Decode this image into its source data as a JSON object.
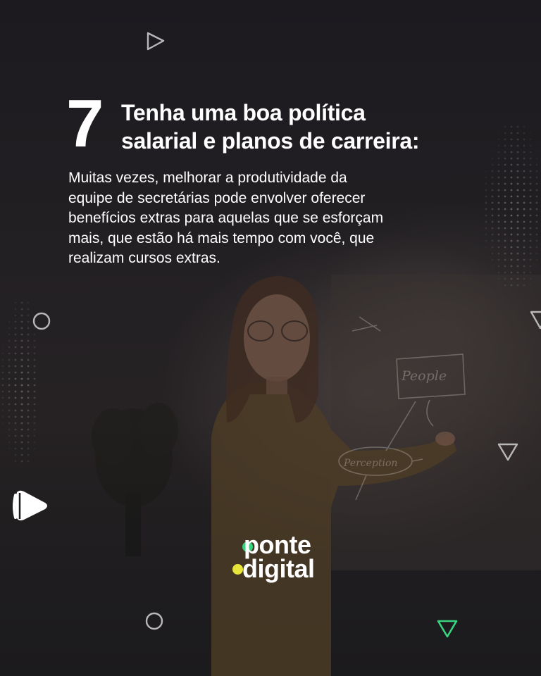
{
  "slide": {
    "number": "7",
    "title_lines": [
      "Tenha uma boa política",
      "salarial e planos de carreira:"
    ],
    "body_lines": [
      "Muitas vezes, melhorar a produtividade da",
      "equipe de secretárias pode envolver oferecer",
      "benefícios extras para aquelas que se esforçam",
      "mais, que estão há mais tempo com você, que",
      "realizam cursos extras."
    ]
  },
  "background": {
    "whiteboard_words": [
      "People",
      "Perception"
    ]
  },
  "logo": {
    "line1": "ponte",
    "line2": "digital",
    "accent_green": "#37d37f",
    "accent_yellow": "#e8e53a"
  },
  "decorations": {
    "icons": [
      "play-triangle-outline-icon",
      "circle-outline-icon",
      "triangle-down-outline-icon",
      "play-blob-icon",
      "triangle-down-green-icon",
      "dot-grid-pattern"
    ]
  },
  "colors": {
    "background": "#1d1b1e",
    "text": "#ffffff",
    "outline_shapes": "#b9b7b8"
  }
}
